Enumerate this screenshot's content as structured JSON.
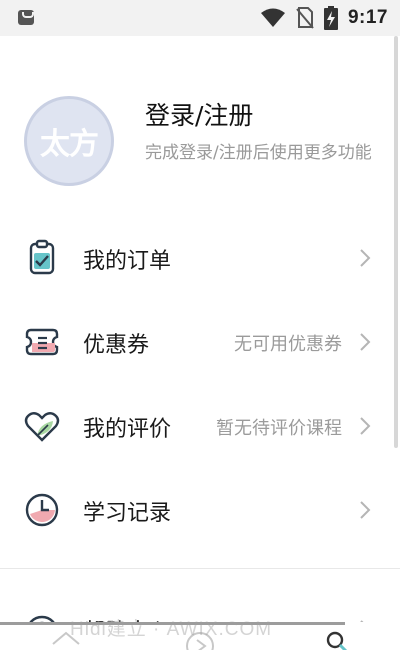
{
  "status_bar": {
    "time": "9:17",
    "icons": [
      "app-notification-icon",
      "wifi-icon",
      "no-sim-icon",
      "battery-charging-icon"
    ]
  },
  "profile": {
    "avatar_text": "太方",
    "login_title": "登录/注册",
    "login_subtitle": "完成登录/注册后使用更多功能"
  },
  "menu": {
    "items": [
      {
        "label": "我的订单",
        "value": "",
        "icon": "clipboard-check-icon"
      },
      {
        "label": "优惠券",
        "value": "无可用优惠券",
        "icon": "coupon-ticket-icon"
      },
      {
        "label": "我的评价",
        "value": "暂无待评价课程",
        "icon": "heart-leaf-icon"
      },
      {
        "label": "学习记录",
        "value": "",
        "icon": "clock-icon"
      }
    ],
    "help": {
      "label": "帮助中心",
      "icon": "help-circle-icon"
    }
  },
  "watermark": "Hidi建立 · AWIX.COM",
  "bottom_tabs": [
    "home-icon",
    "play-icon",
    "search-icon"
  ],
  "colors": {
    "icon_stroke": "#2b3a4a",
    "icon_teal": "#66c4c9",
    "icon_pink": "#f0a9b0",
    "icon_green": "#a8d8a2",
    "avatar_bg": "#dfe4f1",
    "secondary_text": "#9b9b9b"
  }
}
